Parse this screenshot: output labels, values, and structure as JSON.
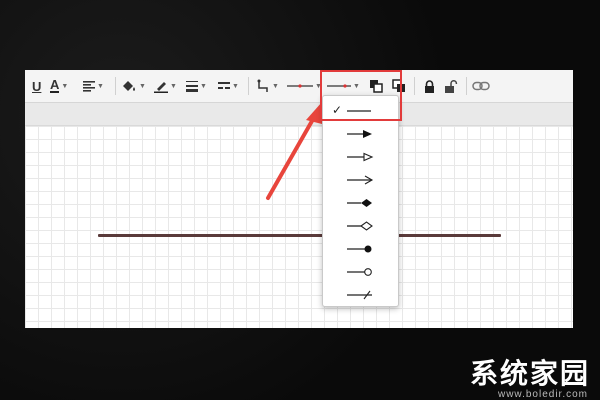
{
  "colors": {
    "highlight": "#e23b3b",
    "line": "#5a3a3a",
    "arrow": "#e8453c"
  },
  "toolbar": {
    "icons": [
      "underline-icon",
      "font-color-icon",
      "align-icon",
      "fill-color-icon",
      "line-color-icon",
      "line-width-icon",
      "line-style-icon",
      "connector-icon",
      "line-end-icon",
      "line-start-icon",
      "bring-front-icon",
      "send-back-icon",
      "lock-icon",
      "unlock-icon",
      "link-icon"
    ]
  },
  "endpoint_menu": {
    "selected_index": 0,
    "check_mark": "✓",
    "options": [
      "none",
      "solid-arrow",
      "hollow-arrow",
      "open-arrow",
      "solid-diamond",
      "hollow-diamond",
      "solid-circle",
      "hollow-circle",
      "slash"
    ]
  },
  "watermark": {
    "title": "系统家园",
    "url": "www.boledir.com"
  }
}
